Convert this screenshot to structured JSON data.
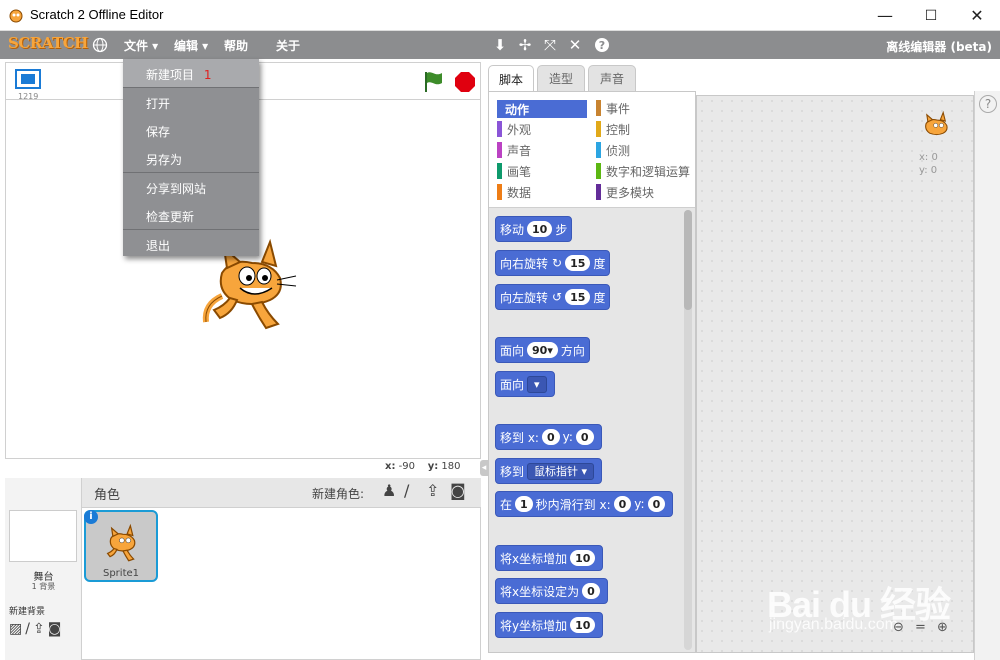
{
  "window": {
    "title": "Scratch 2 Offline Editor",
    "controls": [
      "—",
      "☐",
      "✕"
    ]
  },
  "menubar": {
    "logo": "SCRATCH",
    "menus": [
      "文件 ▾",
      "编辑 ▾",
      "帮助",
      "关于"
    ],
    "edition": "离线编辑器 (beta)"
  },
  "dropdown": {
    "items": [
      {
        "label": "新建项目",
        "badge": "1"
      },
      {
        "label": "打开"
      },
      {
        "label": "保存"
      },
      {
        "label": "另存为"
      },
      {
        "label": "分享到网站"
      },
      {
        "label": "检查更新"
      },
      {
        "label": "退出"
      }
    ]
  },
  "stage": {
    "version": "1219",
    "coords": {
      "x_label": "x:",
      "x": "-90",
      "y_label": "y:",
      "y": "180"
    }
  },
  "sprites": {
    "header": "角色",
    "new_sprite": "新建角色:",
    "stage_label": "舞台",
    "stage_count": "1 背景",
    "new_backdrop": "新建背景",
    "sprite_name": "Sprite1"
  },
  "tabs": [
    "脚本",
    "造型",
    "声音"
  ],
  "categories": {
    "left": [
      {
        "label": "动作",
        "color": "#4a6cd4"
      },
      {
        "label": "外观",
        "color": "#8a55d7"
      },
      {
        "label": "声音",
        "color": "#bb42c3"
      },
      {
        "label": "画笔",
        "color": "#0e9a6c"
      },
      {
        "label": "数据",
        "color": "#ee7d16"
      }
    ],
    "right": [
      {
        "label": "事件",
        "color": "#c88330"
      },
      {
        "label": "控制",
        "color": "#e1a91a"
      },
      {
        "label": "侦测",
        "color": "#2ca5e2"
      },
      {
        "label": "数字和逻辑运算",
        "color": "#5cb712"
      },
      {
        "label": "更多模块",
        "color": "#632d99"
      }
    ]
  },
  "blocks": {
    "move": {
      "a": "移动",
      "v": "10",
      "b": "步"
    },
    "turn_right": {
      "a": "向右旋转",
      "v": "15",
      "b": "度"
    },
    "turn_left": {
      "a": "向左旋转",
      "v": "15",
      "b": "度"
    },
    "point_dir": {
      "a": "面向",
      "v": "90▾",
      "b": "方向"
    },
    "point_towards": {
      "a": "面向"
    },
    "goto_xy": {
      "a": "移到 x:",
      "x": "0",
      "y_label": "y:",
      "y": "0"
    },
    "goto": {
      "a": "移到",
      "v": "鼠标指针"
    },
    "glide": {
      "a": "在",
      "v": "1",
      "b": "秒内滑行到 x:",
      "x": "0",
      "y_label": "y:",
      "y": "0"
    },
    "change_x": {
      "a": "将x坐标增加",
      "v": "10"
    },
    "set_x": {
      "a": "将x坐标设定为",
      "v": "0"
    },
    "change_y": {
      "a": "将y坐标增加",
      "v": "10"
    }
  },
  "script_area": {
    "x_label": "x: 0",
    "y_label": "y: 0"
  },
  "watermark": {
    "brand": "Bai du 经验",
    "url": "jingyan.baidu.com"
  },
  "colors": {
    "menubar": "#8c8d8f",
    "motion": "#4a6cd4",
    "dropdown": "#8f9093",
    "badge": "#e02020"
  }
}
